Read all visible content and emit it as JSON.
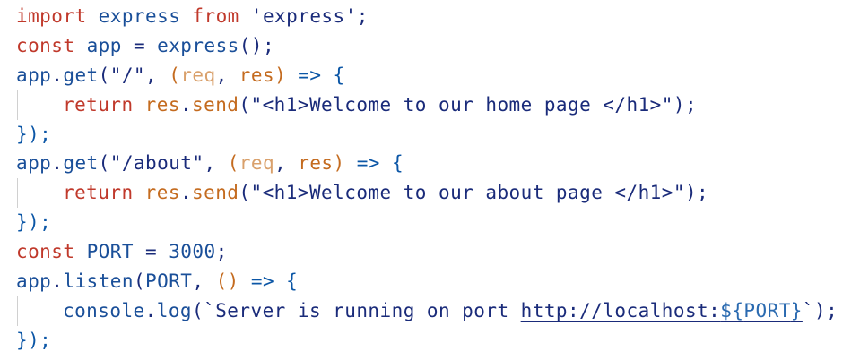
{
  "editor": {
    "lines": [
      "import express from 'express';",
      "const app = express();",
      "app.get(\"/\", (req, res) => {",
      "return res.send(\"<h1>Welcome to our home page </h1>\");",
      "});",
      "app.get(\"/about\", (req, res) => {",
      "return res.send(\"<h1>Welcome to our about page </h1>\");",
      "});",
      "const PORT = 3000;",
      "app.listen(PORT, () => {",
      "console.log(`Server is running on port http://localhost:${PORT}`);",
      "});"
    ],
    "tokens": {
      "import": "import",
      "express": "express",
      "from": "from",
      "express_str": "'express'",
      "semicolon": ";",
      "const": "const",
      "app": "app",
      "eq": "=",
      "paren_call": "()",
      "dot": ".",
      "get": "get",
      "open_paren": "(",
      "close_paren": ")",
      "root_path": "\"/\"",
      "about_path": "\"/about\"",
      "comma": ",",
      "req": "req",
      "res": "res",
      "arrow": "=>",
      "open_brace": "{",
      "close_line": "});",
      "return": "return",
      "send": "send",
      "home_html": "\"<h1>Welcome to our home page </h1>\"",
      "about_html": "\"<h1>Welcome to our about page </h1>\"",
      "PORT": "PORT",
      "port_value": "3000",
      "listen": "listen",
      "empty_params": "()",
      "console": "console",
      "log": "log",
      "backtick": "`",
      "server_text": "Server is running on port ",
      "url_text": "http://localhost:",
      "tmpl_open": "${",
      "tmpl_close": "}"
    }
  }
}
